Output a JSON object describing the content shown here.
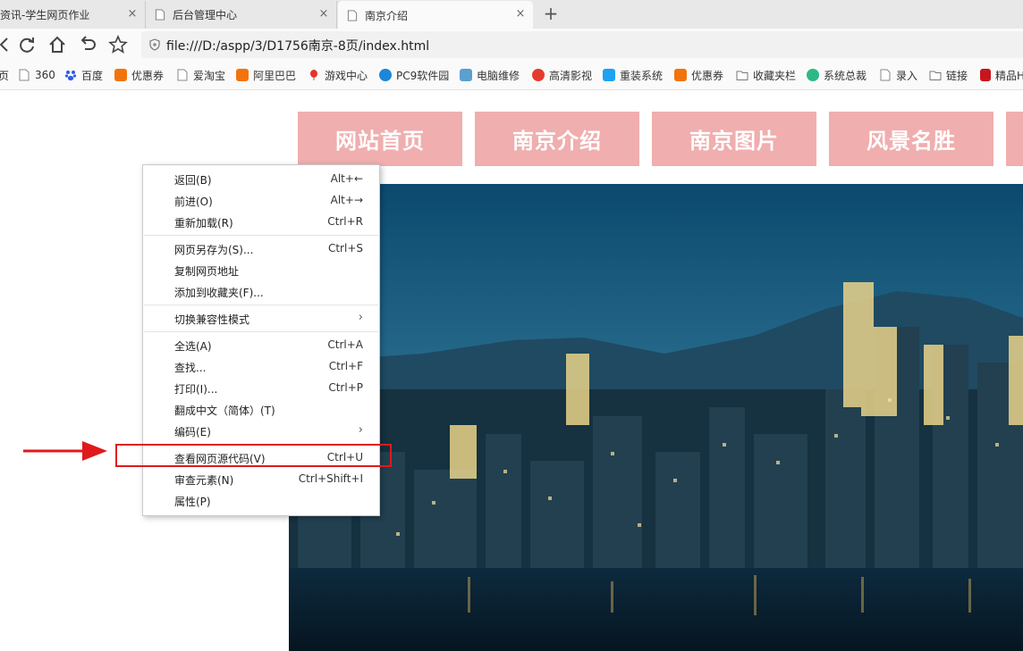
{
  "tabs": [
    {
      "title": "资讯-学生网页作业",
      "close": "×"
    },
    {
      "title": "后台管理中心",
      "close": "×"
    },
    {
      "title": "南京介绍",
      "close": "×"
    }
  ],
  "new_tab_label": "+",
  "address_bar": {
    "url": "file:///D:/aspp/3/D1756南京-8页/index.html"
  },
  "bookmarks": [
    {
      "label": "页",
      "icon": "page-icon"
    },
    {
      "label": "360",
      "icon": "page-icon"
    },
    {
      "label": "百度",
      "icon": "baidu-paw-icon"
    },
    {
      "label": "优惠券",
      "icon": "taobao-icon"
    },
    {
      "label": "爱淘宝",
      "icon": "page-icon"
    },
    {
      "label": "阿里巴巴",
      "icon": "alibaba-icon"
    },
    {
      "label": "游戏中心",
      "icon": "balloon-icon"
    },
    {
      "label": "PC9软件园",
      "icon": "pc9-icon"
    },
    {
      "label": "电脑维修",
      "icon": "repair-person-icon"
    },
    {
      "label": "高清影视",
      "icon": "video-icon"
    },
    {
      "label": "重装系统",
      "icon": "bird-icon"
    },
    {
      "label": "优惠券",
      "icon": "taobao-icon"
    },
    {
      "label": "收藏夹栏",
      "icon": "folder-icon"
    },
    {
      "label": "系统总裁",
      "icon": "e-icon"
    },
    {
      "label": "录入",
      "icon": "page-icon"
    },
    {
      "label": "链接",
      "icon": "folder-icon"
    },
    {
      "label": "精品H",
      "icon": "nav-icon"
    }
  ],
  "site_menu": [
    "网站首页",
    "南京介绍",
    "南京图片",
    "风景名胜"
  ],
  "context_menu": {
    "items": [
      {
        "label": "返回(B)",
        "shortcut": "Alt+←"
      },
      {
        "label": "前进(O)",
        "shortcut": "Alt+→"
      },
      {
        "label": "重新加载(R)",
        "shortcut": "Ctrl+R"
      },
      {
        "label": "网页另存为(S)...",
        "shortcut": "Ctrl+S"
      },
      {
        "label": "复制网页地址",
        "shortcut": ""
      },
      {
        "label": "添加到收藏夹(F)...",
        "shortcut": ""
      },
      {
        "label": "切换兼容性模式",
        "shortcut": "",
        "submenu": "›"
      },
      {
        "label": "全选(A)",
        "shortcut": "Ctrl+A"
      },
      {
        "label": "查找...",
        "shortcut": "Ctrl+F"
      },
      {
        "label": "打印(I)...",
        "shortcut": "Ctrl+P"
      },
      {
        "label": "翻成中文（简体）(T)",
        "shortcut": ""
      },
      {
        "label": "编码(E)",
        "shortcut": "",
        "submenu": "›"
      },
      {
        "label": "查看网页源代码(V)",
        "shortcut": "Ctrl+U"
      },
      {
        "label": "审查元素(N)",
        "shortcut": "Ctrl+Shift+I"
      },
      {
        "label": "属性(P)",
        "shortcut": ""
      }
    ]
  },
  "colors": {
    "menu_button_bg": "#f0aeae",
    "annotation_red": "#e0191c"
  }
}
